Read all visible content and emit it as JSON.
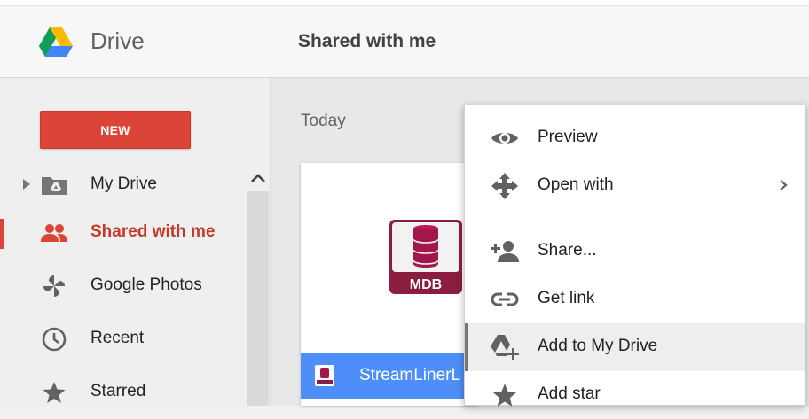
{
  "app": {
    "name": "Drive"
  },
  "header": {
    "title": "Shared with me"
  },
  "sidebar": {
    "new_label": "NEW",
    "items": [
      {
        "label": "My Drive",
        "icon": "my-drive-folder-icon"
      },
      {
        "label": "Shared with me",
        "icon": "shared-people-icon",
        "active": true
      },
      {
        "label": "Google Photos",
        "icon": "google-photos-icon"
      },
      {
        "label": "Recent",
        "icon": "clock-icon"
      },
      {
        "label": "Starred",
        "icon": "star-icon"
      }
    ]
  },
  "main": {
    "section": "Today",
    "file": {
      "name": "StreamLinerL",
      "thumb_label": "MDB",
      "icon": "mdb-database-icon"
    }
  },
  "context_menu": {
    "items": [
      {
        "label": "Preview",
        "icon": "eye-icon"
      },
      {
        "label": "Open with",
        "icon": "move-arrows-icon",
        "submenu": true
      },
      {
        "label": "Share...",
        "icon": "add-person-icon"
      },
      {
        "label": "Get link",
        "icon": "link-icon"
      },
      {
        "label": "Add to My Drive",
        "icon": "add-to-drive-icon",
        "highlighted": true
      },
      {
        "label": "Add star",
        "icon": "star-icon"
      }
    ]
  },
  "colors": {
    "accent_red": "#db4437",
    "file_bar_blue": "#4d8ef8",
    "mdb_maroon": "#a3164b"
  }
}
